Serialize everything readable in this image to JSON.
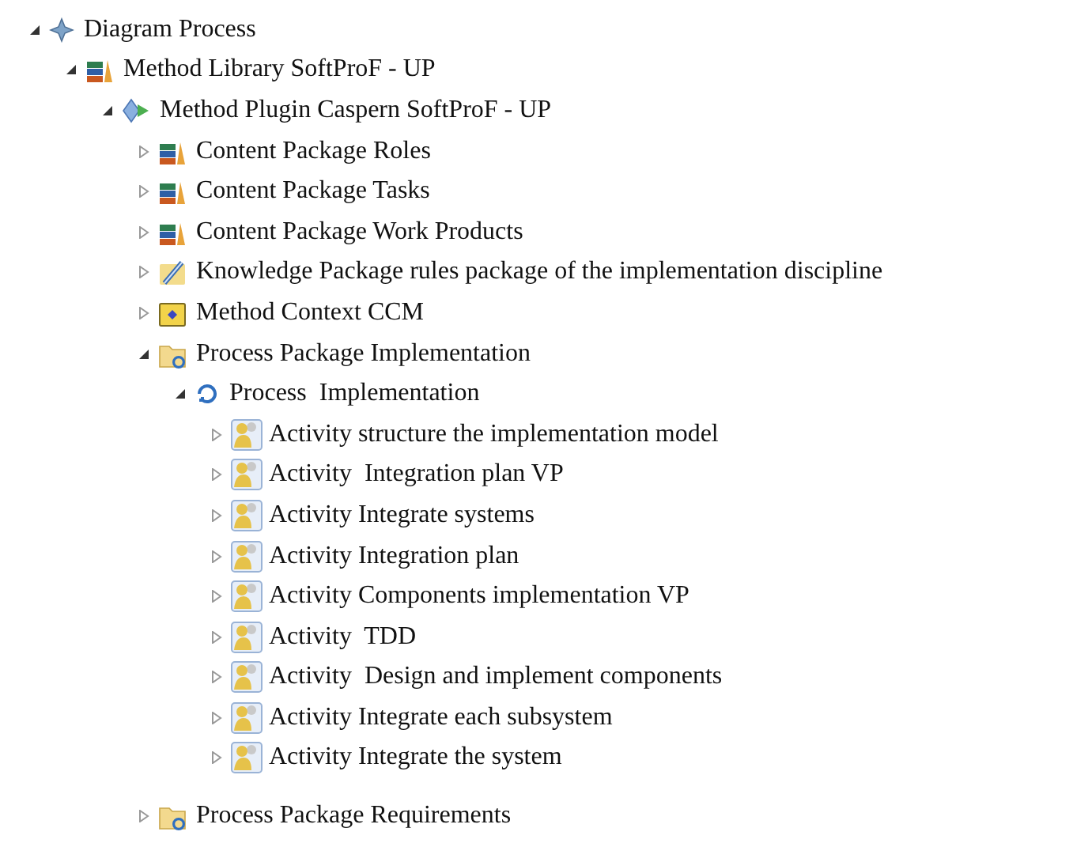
{
  "tree": [
    {
      "label": "Diagram Process",
      "kind": "diagram",
      "expanded": true,
      "children": [
        {
          "label": "Method Library SoftProF - UP",
          "kind": "library",
          "expanded": true,
          "children": [
            {
              "label": "Method Plugin Caspern SoftProF - UP",
              "kind": "plugin",
              "expanded": true,
              "children": [
                {
                  "label": "Content Package Roles",
                  "kind": "content",
                  "expanded": false
                },
                {
                  "label": "Content Package Tasks",
                  "kind": "content",
                  "expanded": false
                },
                {
                  "label": "Content Package Work Products",
                  "kind": "content",
                  "expanded": false
                },
                {
                  "label": "Knowledge Package rules package of the implementation discipline",
                  "kind": "knowledge",
                  "expanded": false
                },
                {
                  "label": "Method Context CCM",
                  "kind": "context",
                  "expanded": false
                },
                {
                  "label": "Process Package Implementation",
                  "kind": "process-package",
                  "expanded": true,
                  "children": [
                    {
                      "label": "Process  Implementation",
                      "kind": "process",
                      "expanded": true,
                      "children": [
                        {
                          "label": "Activity structure the implementation model",
                          "kind": "activity",
                          "expanded": false
                        },
                        {
                          "label": "Activity  Integration plan VP",
                          "kind": "activity",
                          "expanded": false
                        },
                        {
                          "label": "Activity Integrate systems",
                          "kind": "activity",
                          "expanded": false
                        },
                        {
                          "label": "Activity Integration plan",
                          "kind": "activity",
                          "expanded": false
                        },
                        {
                          "label": "Activity Components implementation VP",
                          "kind": "activity",
                          "expanded": false
                        },
                        {
                          "label": "Activity  TDD",
                          "kind": "activity",
                          "expanded": false
                        },
                        {
                          "label": "Activity  Design and implement components",
                          "kind": "activity",
                          "expanded": false
                        },
                        {
                          "label": "Activity Integrate each subsystem",
                          "kind": "activity",
                          "expanded": false
                        },
                        {
                          "label": "Activity Integrate the system",
                          "kind": "activity",
                          "expanded": false
                        }
                      ]
                    }
                  ]
                },
                {
                  "label": "Process Package Requirements",
                  "kind": "process-package",
                  "expanded": false
                }
              ]
            }
          ]
        }
      ]
    }
  ]
}
